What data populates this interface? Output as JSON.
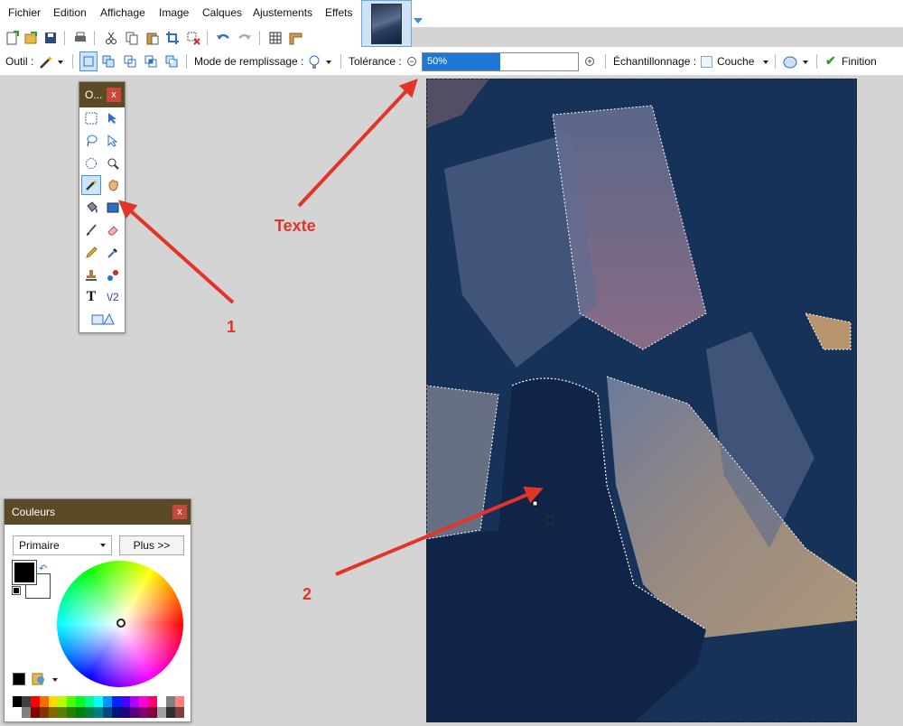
{
  "menu": {
    "items": [
      "Fichier",
      "Edition",
      "Affichage",
      "Image",
      "Calques",
      "Ajustements",
      "Effets"
    ]
  },
  "toolbar": {
    "icons": [
      "new-file-icon",
      "open-file-icon",
      "save-icon",
      "print-icon",
      "cut-icon",
      "copy-icon",
      "paste-icon",
      "crop-icon",
      "deselect-icon",
      "undo-icon",
      "redo-icon",
      "grid-icon",
      "ruler-icon"
    ]
  },
  "options": {
    "tool_label": "Outil :",
    "fill_mode_label": "Mode de remplissage :",
    "tolerance_label": "Tolérance :",
    "tolerance_value": "50%",
    "tolerance_fraction": 0.5,
    "sampling_label": "Échantillonnage :",
    "sampling_value": "Couche",
    "finish_label": "Finition"
  },
  "tools_panel": {
    "title": "O...",
    "close": "x",
    "tools": [
      "rectangle-select-icon",
      "move-selection-icon",
      "lasso-select-icon",
      "move-selected-icon",
      "ellipse-select-icon",
      "zoom-icon",
      "magic-wand-icon",
      "pan-icon",
      "paint-bucket-icon",
      "gradient-icon",
      "paintbrush-icon",
      "eraser-icon",
      "pencil-icon",
      "color-picker-icon",
      "clone-stamp-icon",
      "recolor-icon",
      "text-icon",
      "line-curve-icon",
      "shapes-icon"
    ],
    "line_tool_label": "\\/2"
  },
  "colors_panel": {
    "title": "Couleurs",
    "close": "x",
    "mode_value": "Primaire",
    "more_label": "Plus >>",
    "primary_color": "#000000",
    "secondary_color": "#ffffff",
    "palette_top": [
      "#000000",
      "#404040",
      "#ff0000",
      "#ff6a00",
      "#ffd800",
      "#b6ff00",
      "#4cff00",
      "#00ff21",
      "#00ff90",
      "#00ffff",
      "#0094ff",
      "#0026ff",
      "#4800ff",
      "#b200ff",
      "#ff00dc",
      "#ff006e",
      "#ffffff",
      "#808080",
      "#ff7f7f"
    ],
    "palette_bottom": [
      "#ffffff",
      "#808080",
      "#7f0000",
      "#7f3300",
      "#7f6a00",
      "#5b7f00",
      "#267f00",
      "#007f0e",
      "#007f46",
      "#007f7f",
      "#004a7f",
      "#00137f",
      "#21007f",
      "#57007f",
      "#7f006e",
      "#7f0037",
      "#a0a0a0",
      "#303030",
      "#7f3f3f"
    ]
  },
  "annotations": {
    "label_1": "1",
    "label_2": "2",
    "label_texte": "Texte",
    "color": "#e3342a"
  },
  "accent": "#1e78d6"
}
